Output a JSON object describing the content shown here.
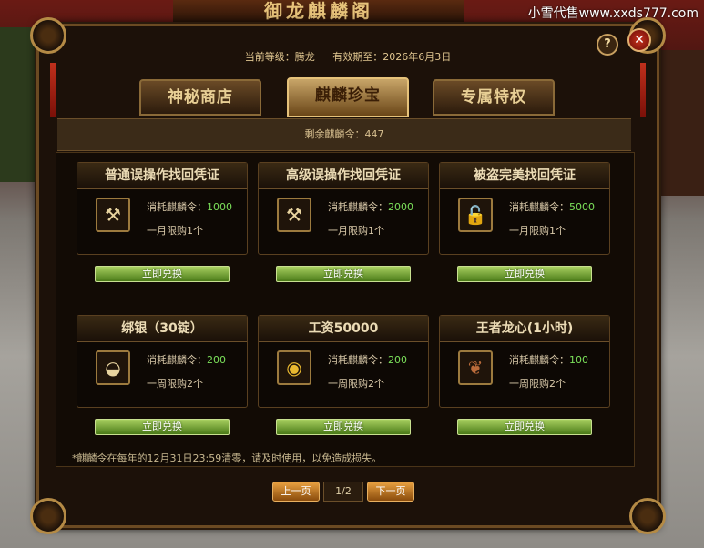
{
  "background": {
    "banner_title": "御龙麒麟阁",
    "watermark": "小雪代售www.xxds777.com"
  },
  "window": {
    "help_label": "?",
    "close_label": "✕",
    "info": {
      "level_label": "当前等级：腾龙",
      "expiry_label": "有效期至：2026年6月3日"
    },
    "tabs": [
      {
        "label": "神秘商店",
        "active": false
      },
      {
        "label": "麒麟珍宝",
        "active": true
      },
      {
        "label": "专属特权",
        "active": false
      }
    ],
    "balance": "剩余麒麟令：447",
    "items": [
      {
        "title": "普通误操作找回凭证",
        "cost_label": "消耗麒麟令：",
        "cost": "1000",
        "limit": "一月限购1个",
        "icon": "wrench-icon",
        "button": "立即兑换"
      },
      {
        "title": "高级误操作找回凭证",
        "cost_label": "消耗麒麟令：",
        "cost": "2000",
        "limit": "一月限购1个",
        "icon": "wrench-icon",
        "button": "立即兑换"
      },
      {
        "title": "被盗完美找回凭证",
        "cost_label": "消耗麒麟令：",
        "cost": "5000",
        "limit": "一月限购1个",
        "icon": "lock-icon",
        "button": "立即兑换"
      },
      {
        "title": "绑银（30锭）",
        "cost_label": "消耗麒麟令：",
        "cost": "200",
        "limit": "一周限购2个",
        "icon": "silver-ingot-icon",
        "button": "立即兑换"
      },
      {
        "title": "工资50000",
        "cost_label": "消耗麒麟令：",
        "cost": "200",
        "limit": "一周限购2个",
        "icon": "gold-coins-icon",
        "button": "立即兑换"
      },
      {
        "title": "王者龙心(1小时)",
        "cost_label": "消耗麒麟令：",
        "cost": "100",
        "limit": "一周限购2个",
        "icon": "dragon-heart-icon",
        "button": "立即兑换"
      }
    ],
    "note": "*麒麟令在每年的12月31日23:59清零，请及时使用，以免造成损失。",
    "pagination": {
      "prev": "上一页",
      "page": "1/2",
      "next": "下一页"
    }
  },
  "colors": {
    "cost_value": "#7be05a",
    "redeem_button": "#6aa02a",
    "page_button": "#c8782a"
  }
}
